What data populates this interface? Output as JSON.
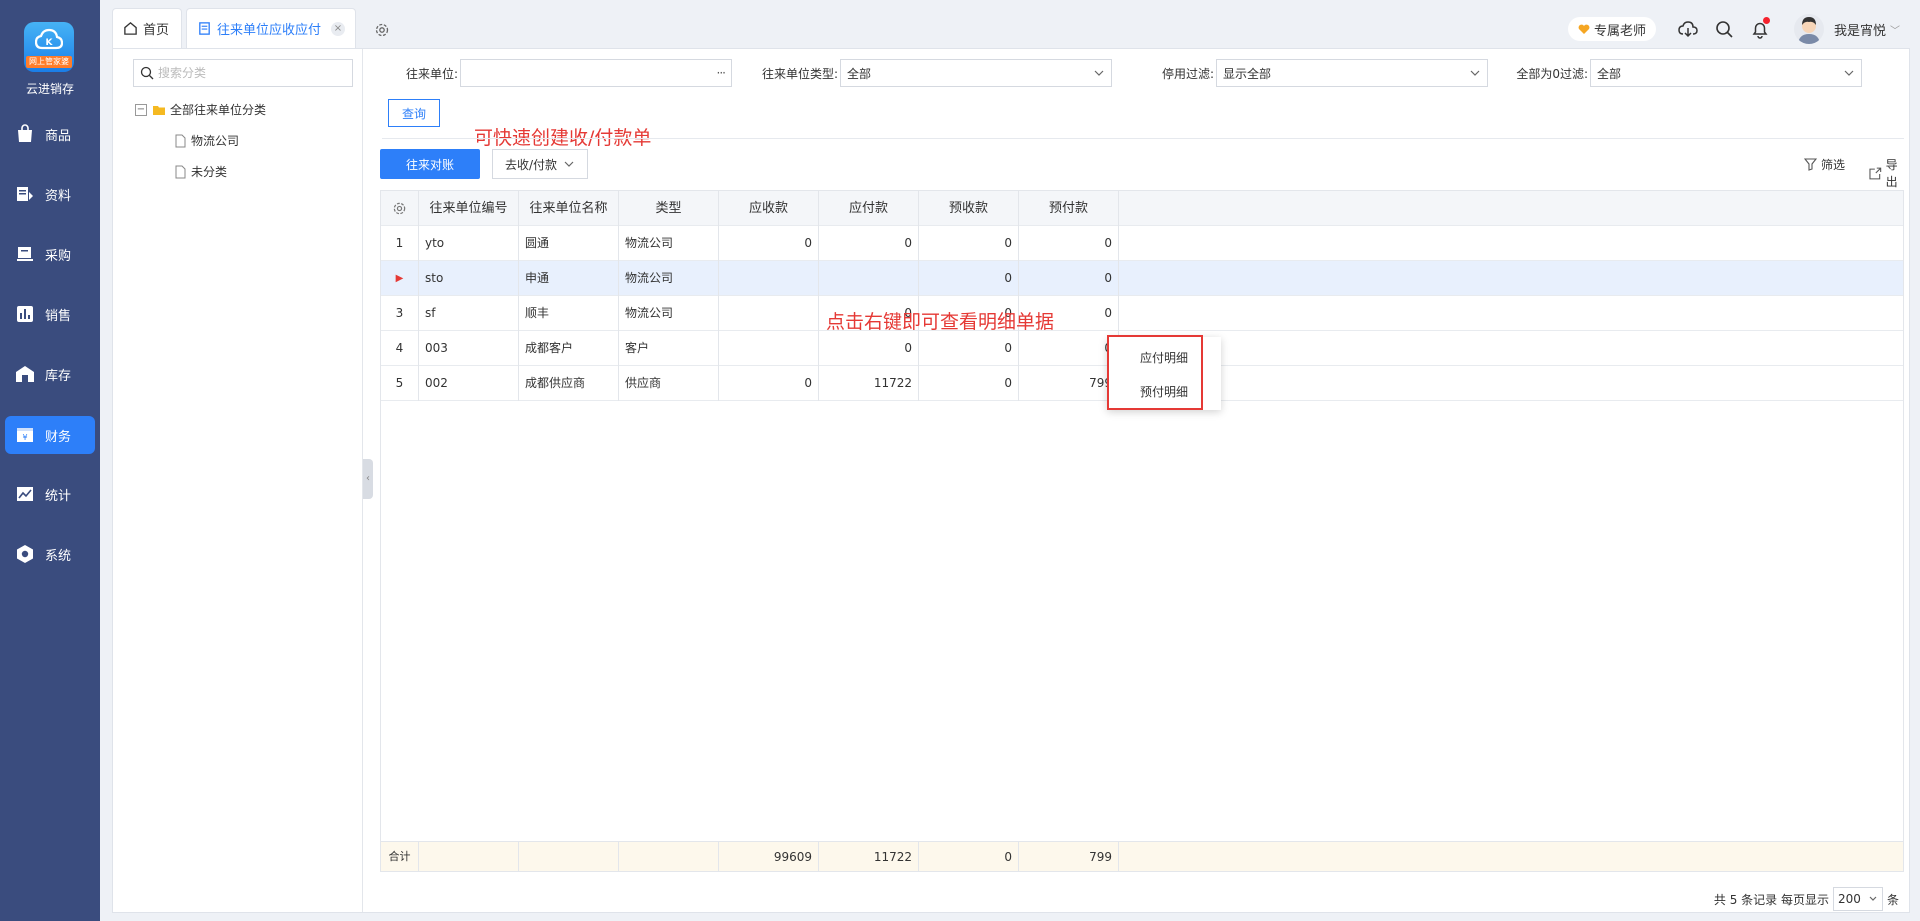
{
  "app": {
    "name": "云进销存",
    "logo_badge": "网上管家婆",
    "accent": "#2d7ff9"
  },
  "sidebar": {
    "items": [
      {
        "label": "商品",
        "icon": "bag-icon"
      },
      {
        "label": "资料",
        "icon": "document-icon"
      },
      {
        "label": "采购",
        "icon": "purchase-icon"
      },
      {
        "label": "销售",
        "icon": "bar-chart-icon"
      },
      {
        "label": "库存",
        "icon": "warehouse-icon"
      },
      {
        "label": "财务",
        "icon": "finance-icon",
        "active": true
      },
      {
        "label": "统计",
        "icon": "statistics-icon"
      },
      {
        "label": "系统",
        "icon": "hexagon-gear-icon"
      }
    ]
  },
  "tabs": [
    {
      "label": "首页",
      "icon": "home-icon"
    },
    {
      "label": "往来单位应收应付",
      "icon": "document-icon",
      "active": true,
      "close": "×"
    }
  ],
  "header": {
    "teacher": "专属老师",
    "username": "我是宵悦",
    "caret": "﹀"
  },
  "tree": {
    "search_placeholder": "搜索分类",
    "root": {
      "toggle": "−",
      "label": "全部往来单位分类"
    },
    "children": [
      "物流公司",
      "未分类"
    ],
    "collapse_glyph": "‹"
  },
  "filters": [
    {
      "label": "往来单位:",
      "value": "",
      "control": "ellipsis",
      "suffix": "···"
    },
    {
      "label": "往来单位类型:",
      "value": "全部",
      "control": "select"
    },
    {
      "label": "停用过滤:",
      "value": "显示全部",
      "control": "select"
    },
    {
      "label": "全部为0过滤:",
      "value": "全部",
      "control": "select"
    }
  ],
  "buttons": {
    "query": "查询",
    "reconcile": "往来对账",
    "receive_pay": "去收/付款",
    "filter": "筛选",
    "export": "导出"
  },
  "annotations": {
    "top": "可快速创建收/付款单",
    "middle": "点击右键即可查看明细单据"
  },
  "table": {
    "columns": [
      "往来单位编号",
      "往来单位名称",
      "类型",
      "应收款",
      "应付款",
      "预收款",
      "预付款"
    ],
    "rows": [
      {
        "idx": "1",
        "code": "yto",
        "name": "圆通",
        "type": "物流公司",
        "receivable": "0",
        "payable": "0",
        "prereceived": "0",
        "prepaid": "0"
      },
      {
        "idx": "▶",
        "code": "sto",
        "name": "申通",
        "type": "物流公司",
        "receivable": "",
        "payable": "",
        "prereceived": "0",
        "prepaid": "0",
        "selected": true
      },
      {
        "idx": "3",
        "code": "sf",
        "name": "顺丰",
        "type": "物流公司",
        "receivable": "",
        "payable": "0",
        "prereceived": "0",
        "prepaid": "0"
      },
      {
        "idx": "4",
        "code": "003",
        "name": "成都客户",
        "type": "客户",
        "receivable": "",
        "payable": "0",
        "prereceived": "0",
        "prepaid": "0"
      },
      {
        "idx": "5",
        "code": "002",
        "name": "成都供应商",
        "type": "供应商",
        "receivable": "0",
        "payable": "11722",
        "prereceived": "0",
        "prepaid": "799"
      }
    ],
    "footer": {
      "label": "合计",
      "receivable": "99609",
      "payable": "11722",
      "prereceived": "0",
      "prepaid": "799"
    }
  },
  "context_menu": {
    "items": [
      "应付明细",
      "预付明细"
    ]
  },
  "pager": {
    "summary": "共 5 条记录  每页显示",
    "page_size": "200",
    "unit": "条"
  }
}
